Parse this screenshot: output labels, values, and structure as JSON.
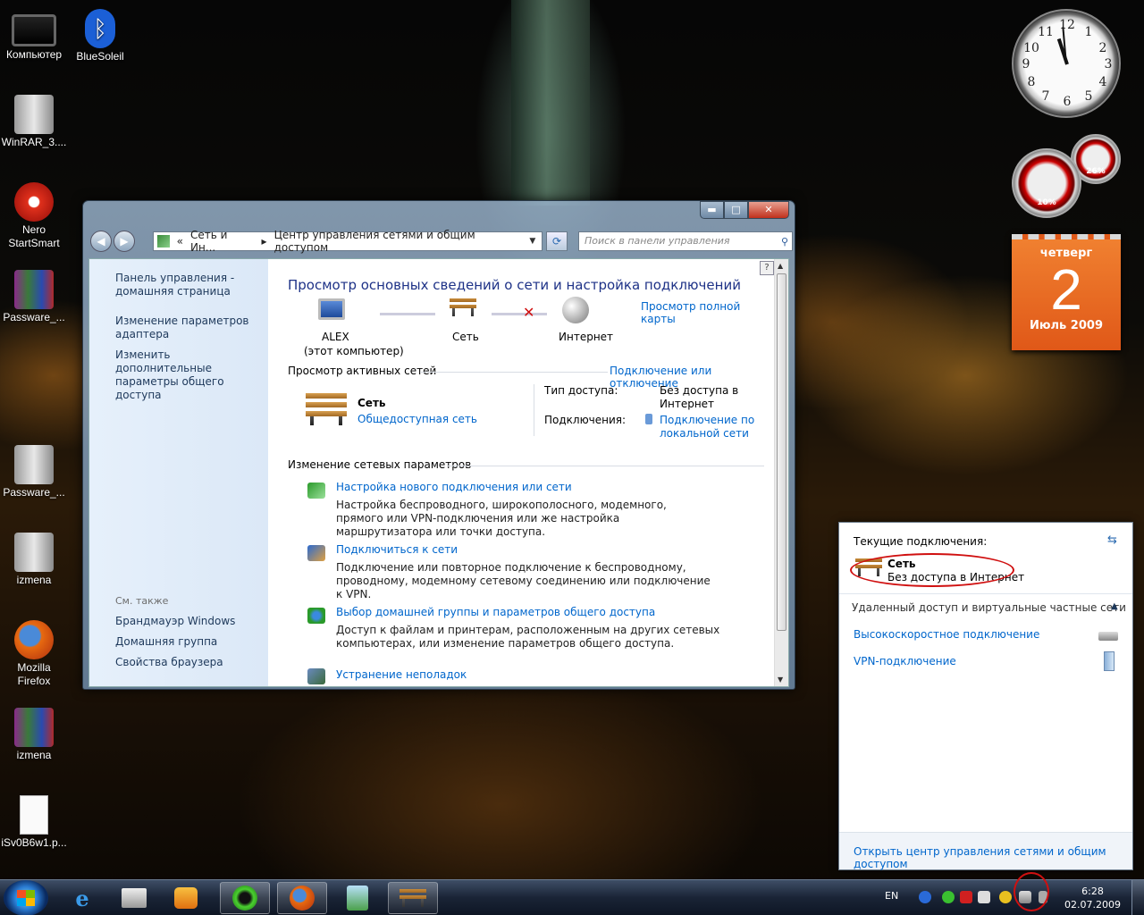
{
  "desktop_icons": [
    {
      "label": "Компьютер",
      "icon": "computer-icon"
    },
    {
      "label": "BlueSoleil",
      "icon": "bluetooth-icon"
    },
    {
      "label": "WinRAR_3....",
      "icon": "winrar-archive-icon"
    },
    {
      "label": "Nero StartSmart",
      "icon": "nero-icon"
    },
    {
      "label": "Passware_...",
      "icon": "winrar-archive-icon"
    },
    {
      "label": "Passware_...",
      "icon": "zip-folder-icon"
    },
    {
      "label": "izmena",
      "icon": "zip-folder-icon"
    },
    {
      "label": "Mozilla Firefox",
      "icon": "firefox-icon"
    },
    {
      "label": "izmena",
      "icon": "winrar-archive-icon"
    },
    {
      "label": "iSv0B6w1.p...",
      "icon": "file-icon"
    }
  ],
  "gadgets": {
    "clock_numbers": [
      "12",
      "1",
      "2",
      "3",
      "4",
      "5",
      "6",
      "7",
      "8",
      "9",
      "10",
      "11"
    ],
    "cpu_meter": "10%",
    "mem_meter": "26%",
    "calendar": {
      "weekday": "четверг",
      "day": "2",
      "month_year": "Июль 2009"
    }
  },
  "window": {
    "controls": {
      "minimize": "▬",
      "maximize": "□",
      "close": "✕"
    },
    "address": {
      "prefix": "«",
      "crumb1": "Сеть и Ин...",
      "sep": "▸",
      "crumb2": "Центр управления сетями и общим доступом"
    },
    "search_placeholder": "Поиск в панели управления",
    "sidebar": {
      "links": [
        "Панель управления - домашняя страница",
        "Изменение параметров адаптера",
        "Изменить дополнительные параметры общего доступа"
      ],
      "see_also": "См. также",
      "see_also_links": [
        "Брандмауэр Windows",
        "Домашняя группа",
        "Свойства браузера"
      ]
    },
    "title": "Просмотр основных сведений о сети и настройка подключений",
    "full_map_link": "Просмотр полной карты",
    "map": {
      "computer": "ALEX",
      "computer_sub": "(этот компьютер)",
      "network": "Сеть",
      "internet": "Интернет"
    },
    "active_networks": {
      "heading": "Просмотр активных сетей",
      "connect_link": "Подключение или отключение",
      "network_name": "Сеть",
      "network_type": "Общедоступная сеть",
      "access_label": "Тип доступа:",
      "access_value": "Без доступа в Интернет",
      "connections_label": "Подключения:",
      "connections_value": "Подключение по локальной сети"
    },
    "change_settings": {
      "heading": "Изменение сетевых параметров",
      "items": [
        {
          "title": "Настройка нового подключения или сети",
          "desc": "Настройка беспроводного, широкополосного, модемного, прямого или VPN-подключения или же настройка маршрутизатора или точки доступа.",
          "icon": "new-connection-icon"
        },
        {
          "title": "Подключиться к сети",
          "desc": "Подключение или повторное подключение к беспроводному, проводному, модемному сетевому соединению или подключение к VPN.",
          "icon": "connect-network-icon"
        },
        {
          "title": "Выбор домашней группы и параметров общего доступа",
          "desc": "Доступ к файлам и принтерам, расположенным на других сетевых компьютерах, или изменение параметров общего доступа.",
          "icon": "homegroup-icon"
        },
        {
          "title": "Устранение неполадок",
          "desc": "",
          "icon": "troubleshoot-icon"
        }
      ]
    }
  },
  "flyout": {
    "current_label": "Текущие подключения:",
    "network_name": "Сеть",
    "network_status": "Без доступа в Интернет",
    "remote_heading": "Удаленный доступ и виртуальные частные сети",
    "items": [
      "Высокоскоростное подключение",
      "VPN-подключение"
    ],
    "footer_link": "Открыть центр управления сетями и общим доступом"
  },
  "taskbar": {
    "lang": "EN",
    "time": "6:28",
    "date": "02.07.2009",
    "apps": [
      "ie-icon",
      "printer-icon",
      "media-player-icon",
      "spider-icon",
      "firefox-icon",
      "network-tool-icon",
      "network-center-icon"
    ]
  }
}
